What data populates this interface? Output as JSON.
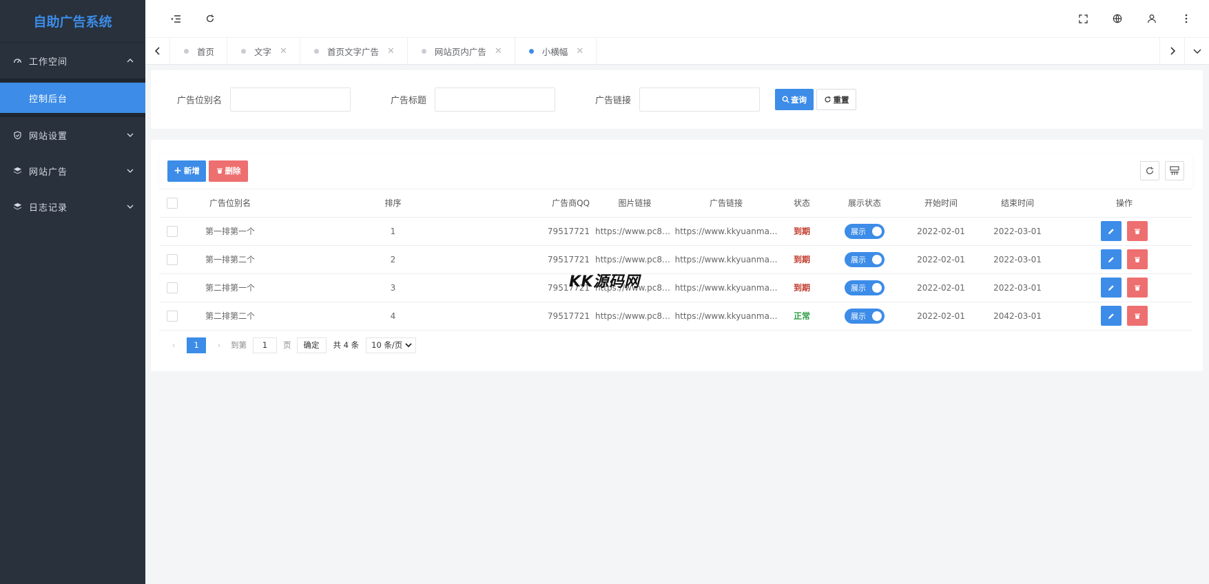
{
  "brand": "自助广告系统",
  "sidebar": {
    "items": [
      {
        "label": "工作空间",
        "icon": "dashboard-icon",
        "expanded": true
      },
      {
        "label": "网站设置",
        "icon": "shield-icon"
      },
      {
        "label": "网站广告",
        "icon": "layers-icon"
      },
      {
        "label": "日志记录",
        "icon": "layers-icon"
      }
    ],
    "sub_item": "控制后台"
  },
  "tabs": [
    {
      "label": "首页",
      "closable": false
    },
    {
      "label": "文字",
      "closable": true
    },
    {
      "label": "首页文字广告",
      "closable": true
    },
    {
      "label": "网站页内广告",
      "closable": true
    },
    {
      "label": "小横幅",
      "closable": true,
      "active": true
    }
  ],
  "search": {
    "label_name": "广告位别名",
    "label_title": "广告标题",
    "label_link": "广告链接",
    "query_btn": "查询",
    "reset_btn": "重置"
  },
  "toolbar": {
    "add_btn": "新增",
    "delete_btn": "删除"
  },
  "table": {
    "headers": [
      "广告位别名",
      "排序",
      "广告商QQ",
      "图片链接",
      "广告链接",
      "状态",
      "展示状态",
      "开始时间",
      "结束时间",
      "操作"
    ],
    "rows": [
      {
        "name": "第一排第一个",
        "order": "1",
        "qq": "79517721",
        "img": "https://www.pc880...",
        "link": "https://www.kkyuanma...",
        "status": "到期",
        "status_type": "expired",
        "display": "展示",
        "start": "2022-02-01",
        "end": "2022-03-01"
      },
      {
        "name": "第一排第二个",
        "order": "2",
        "qq": "79517721",
        "img": "https://www.pc880...",
        "link": "https://www.kkyuanma...",
        "status": "到期",
        "status_type": "expired",
        "display": "展示",
        "start": "2022-02-01",
        "end": "2022-03-01"
      },
      {
        "name": "第二排第一个",
        "order": "3",
        "qq": "79517721",
        "img": "https://www.pc880...",
        "link": "https://www.kkyuanma...",
        "status": "到期",
        "status_type": "expired",
        "display": "展示",
        "start": "2022-02-01",
        "end": "2022-03-01"
      },
      {
        "name": "第二排第二个",
        "order": "4",
        "qq": "79517721",
        "img": "https://www.pc880...",
        "link": "https://www.kkyuanma...",
        "status": "正常",
        "status_type": "normal",
        "display": "展示",
        "start": "2022-02-01",
        "end": "2042-03-01"
      }
    ]
  },
  "pager": {
    "current": "1",
    "goto_label": "到第",
    "goto_value": "1",
    "page_unit": "页",
    "confirm": "确定",
    "total": "共 4 条",
    "page_size": "10 条/页"
  },
  "watermark": "KK源码网",
  "colors": {
    "accent": "#3c8ce8",
    "danger": "#ee6f6f",
    "sidebar": "#28313c",
    "expired": "#c0392b",
    "normal": "#2f9e44"
  }
}
